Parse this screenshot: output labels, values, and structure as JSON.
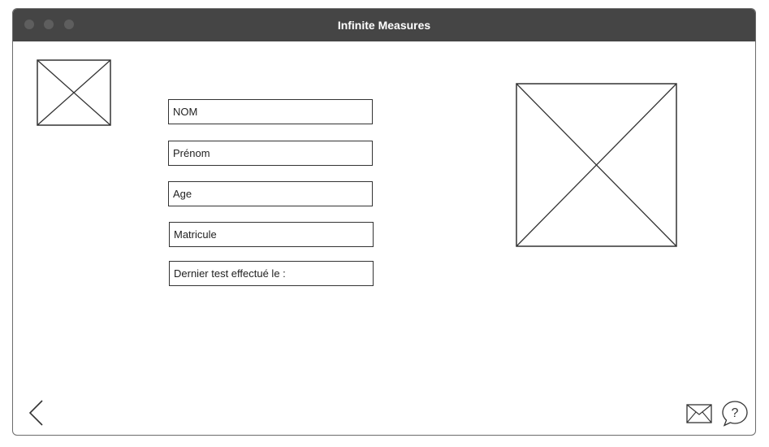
{
  "window": {
    "title": "Infinite Measures"
  },
  "form": {
    "fields": [
      {
        "name": "nom",
        "label": "NOM"
      },
      {
        "name": "prenom",
        "label": "Prénom"
      },
      {
        "name": "age",
        "label": "Age"
      },
      {
        "name": "matricule",
        "label": "Matricule"
      },
      {
        "name": "dernier-test",
        "label": "Dernier test effectué le :"
      }
    ]
  },
  "icons": {
    "back": "chevron-left-icon",
    "mail": "envelope-icon",
    "help": "question-mark-icon",
    "logo": "image-placeholder-icon",
    "photo": "image-placeholder-icon"
  }
}
